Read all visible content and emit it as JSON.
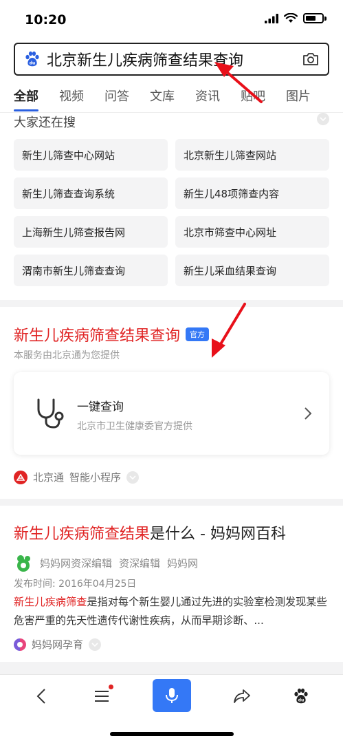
{
  "status": {
    "time": "10:20"
  },
  "search": {
    "query": "北京新生儿疾病筛查结果查询"
  },
  "tabs": [
    {
      "label": "全部",
      "active": true
    },
    {
      "label": "视频"
    },
    {
      "label": "问答"
    },
    {
      "label": "文库"
    },
    {
      "label": "资讯"
    },
    {
      "label": "贴吧"
    },
    {
      "label": "图片"
    }
  ],
  "related": {
    "title": "大家还在搜",
    "items": [
      "新生儿筛查中心网站",
      "北京新生儿筛查网站",
      "新生儿筛查查询系统",
      "新生儿48项筛查内容",
      "上海新生儿筛查报告网",
      "北京市筛查中心网址",
      "渭南市新生儿筛查查询",
      "新生儿采血结果查询"
    ]
  },
  "official": {
    "title": "新生儿疾病筛查结果查询",
    "badge": "官方",
    "subtitle": "本服务由北京通为您提供",
    "card_title": "一键查询",
    "card_subtitle": "北京市卫生健康委官方提供",
    "provider": "北京通",
    "provider_type": "智能小程序"
  },
  "article": {
    "title_highlight": "新生儿疾病筛查结果",
    "title_rest": "是什么 - 妈妈网百科",
    "meta": [
      "妈妈网资深编辑",
      "资深编辑",
      "妈妈网"
    ],
    "date": "发布时间: 2016年04月25日",
    "body_highlight": "新生儿疾病筛查",
    "body_rest": "是指对每个新生婴儿通过先进的实验室检测发现某些危害严重的先天性遗传代谢性疾病，从而早期诊断、...",
    "source": "妈妈网孕育"
  },
  "colors": {
    "accent_blue": "#3478f6",
    "highlight_red": "#e02424"
  }
}
